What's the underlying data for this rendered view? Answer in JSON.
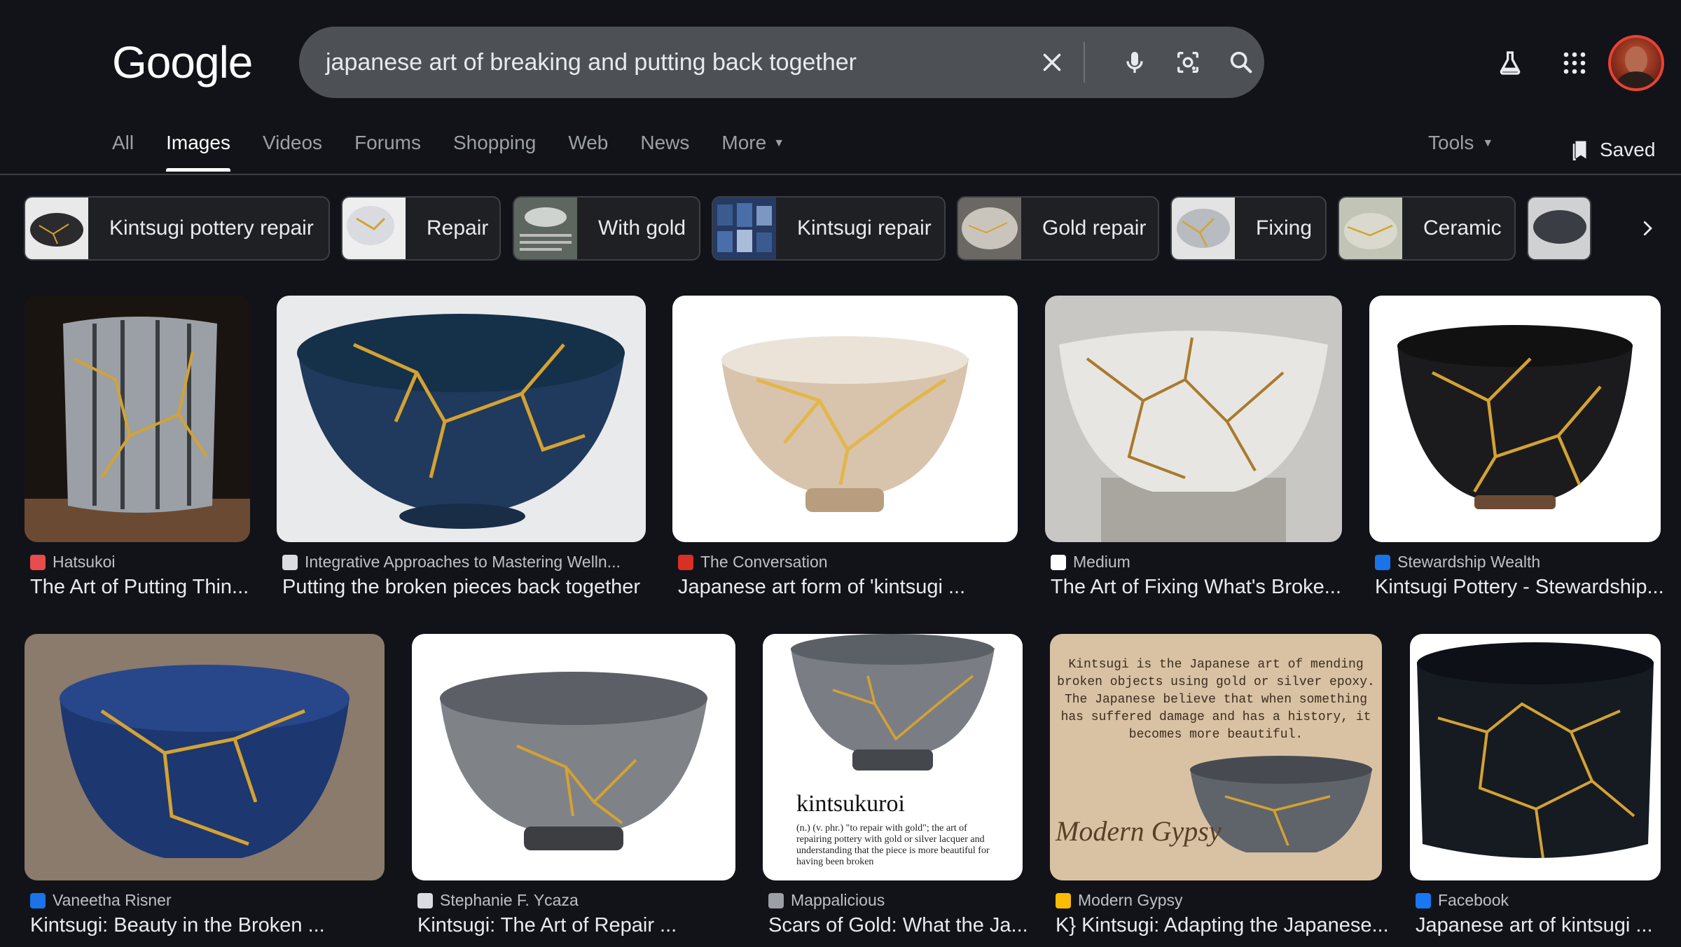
{
  "logo": "Google",
  "search": {
    "query": "japanese art of breaking and putting back together",
    "clear_icon": "close-icon",
    "voice_icon": "mic-icon",
    "lens_icon": "lens-icon",
    "search_icon": "search-icon"
  },
  "header_icons": [
    "labs-flask-icon",
    "apps-grid-icon",
    "account-avatar"
  ],
  "tabs": [
    {
      "label": "All",
      "active": false
    },
    {
      "label": "Images",
      "active": true
    },
    {
      "label": "Videos",
      "active": false
    },
    {
      "label": "Forums",
      "active": false
    },
    {
      "label": "Shopping",
      "active": false
    },
    {
      "label": "Web",
      "active": false
    },
    {
      "label": "News",
      "active": false
    },
    {
      "label": "More",
      "active": false
    }
  ],
  "tools_label": "Tools",
  "saved_label": "Saved",
  "chips": [
    {
      "label": "Kintsugi pottery repair",
      "thumb": "#2b2b2e"
    },
    {
      "label": "Repair",
      "thumb": "#d9dbe0"
    },
    {
      "label": "With gold",
      "thumb": "#5e6660"
    },
    {
      "label": "Kintsugi repair",
      "thumb": "#263a63"
    },
    {
      "label": "Gold repair",
      "thumb": "#c9c5bd"
    },
    {
      "label": "Fixing",
      "thumb": "#b8bbbf"
    },
    {
      "label": "Ceramic",
      "thumb": "#c2c4b6"
    },
    {
      "label": "",
      "thumb": "#3a3d44"
    }
  ],
  "results": [
    {
      "source": "Hatsukoi",
      "title": "The Art of Putting Thin...",
      "icon_color": "#e84c4c",
      "bg": "#1a1411",
      "bowl": "#9aa0a6"
    },
    {
      "source": "Integrative Approaches to Mastering Welln...",
      "title": "Putting the broken pieces back together",
      "icon_color": "#dadce0",
      "bg": "#e9eaec",
      "bowl": "#1f3a5c"
    },
    {
      "source": "The Conversation",
      "title": "Japanese art form of 'kintsugi ...",
      "icon_color": "#d93025",
      "bg": "#ffffff",
      "bowl": "#d8c4ad"
    },
    {
      "source": "Medium",
      "title": "The Art of Fixing What's Broke...",
      "icon_color": "#ffffff",
      "bg": "#c9c7c3",
      "bowl": "#e8e6e2"
    },
    {
      "source": "Stewardship Wealth",
      "title": "Kintsugi Pottery - Stewardship...",
      "icon_color": "#1a73e8",
      "bg": "#ffffff",
      "bowl": "#1b1b1d"
    },
    {
      "source": "Vaneetha Risner",
      "title": "Kintsugi: Beauty in the Broken ...",
      "icon_color": "#1a73e8",
      "bg": "#8a7b6c",
      "bowl": "#1d3770"
    },
    {
      "source": "Stephanie F. Ycaza",
      "title": "Kintsugi: The Art of Repair ...",
      "icon_color": "#dadce0",
      "bg": "#ffffff",
      "bowl": "#7f8388"
    },
    {
      "source": "Mappalicious",
      "title": "Scars of Gold: What the Ja...",
      "icon_color": "#9aa0a6",
      "bg": "#ffffff",
      "bowl": "#7a7e84",
      "caption_title": "kintsukuroi",
      "caption_body": "(n.) (v. phr.) \"to repair with gold\"; the art of repairing pottery with gold or silver lacquer and understanding that the piece is more beautiful for having been broken"
    },
    {
      "source": "Modern Gypsy",
      "title": "K} Kintsugi: Adapting the Japanese...",
      "icon_color": "#fbbc04",
      "bg": "#d9c2a3",
      "bowl": "#5f646b",
      "overlay_text": "Kintsugi is the Japanese art of mending broken objects using gold or silver epoxy. The Japanese believe that when something has suffered damage and has a history, it becomes more beautiful.",
      "signature": "Modern Gypsy"
    },
    {
      "source": "Facebook",
      "title": "Japanese art of kintsugi ...",
      "icon_color": "#1877f2",
      "bg": "#ffffff",
      "bowl": "#161b22"
    }
  ],
  "colors": {
    "gold": "#d4a233",
    "bg": "#121318",
    "search_bg": "#4d5156"
  }
}
